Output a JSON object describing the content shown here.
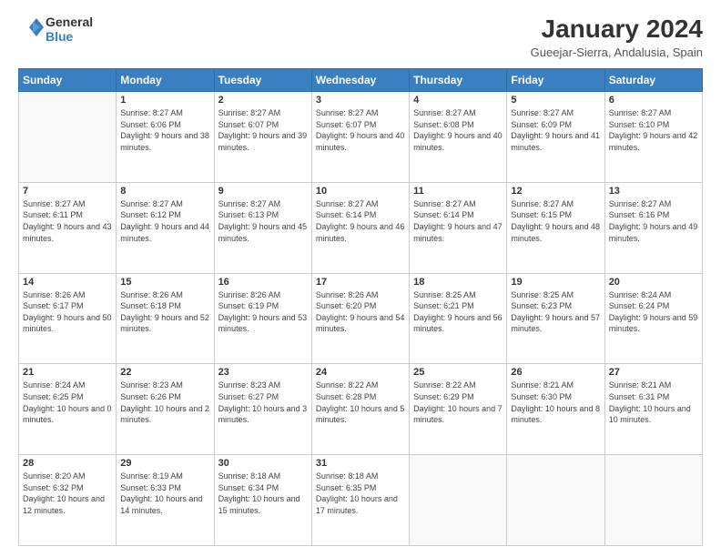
{
  "header": {
    "logo_line1": "General",
    "logo_line2": "Blue",
    "title": "January 2024",
    "location": "Gueejar-Sierra, Andalusia, Spain"
  },
  "days_of_week": [
    "Sunday",
    "Monday",
    "Tuesday",
    "Wednesday",
    "Thursday",
    "Friday",
    "Saturday"
  ],
  "weeks": [
    [
      {
        "day": "",
        "sunrise": "",
        "sunset": "",
        "daylight": ""
      },
      {
        "day": "1",
        "sunrise": "Sunrise: 8:27 AM",
        "sunset": "Sunset: 6:06 PM",
        "daylight": "Daylight: 9 hours and 38 minutes."
      },
      {
        "day": "2",
        "sunrise": "Sunrise: 8:27 AM",
        "sunset": "Sunset: 6:07 PM",
        "daylight": "Daylight: 9 hours and 39 minutes."
      },
      {
        "day": "3",
        "sunrise": "Sunrise: 8:27 AM",
        "sunset": "Sunset: 6:07 PM",
        "daylight": "Daylight: 9 hours and 40 minutes."
      },
      {
        "day": "4",
        "sunrise": "Sunrise: 8:27 AM",
        "sunset": "Sunset: 6:08 PM",
        "daylight": "Daylight: 9 hours and 40 minutes."
      },
      {
        "day": "5",
        "sunrise": "Sunrise: 8:27 AM",
        "sunset": "Sunset: 6:09 PM",
        "daylight": "Daylight: 9 hours and 41 minutes."
      },
      {
        "day": "6",
        "sunrise": "Sunrise: 8:27 AM",
        "sunset": "Sunset: 6:10 PM",
        "daylight": "Daylight: 9 hours and 42 minutes."
      }
    ],
    [
      {
        "day": "7",
        "sunrise": "Sunrise: 8:27 AM",
        "sunset": "Sunset: 6:11 PM",
        "daylight": "Daylight: 9 hours and 43 minutes."
      },
      {
        "day": "8",
        "sunrise": "Sunrise: 8:27 AM",
        "sunset": "Sunset: 6:12 PM",
        "daylight": "Daylight: 9 hours and 44 minutes."
      },
      {
        "day": "9",
        "sunrise": "Sunrise: 8:27 AM",
        "sunset": "Sunset: 6:13 PM",
        "daylight": "Daylight: 9 hours and 45 minutes."
      },
      {
        "day": "10",
        "sunrise": "Sunrise: 8:27 AM",
        "sunset": "Sunset: 6:14 PM",
        "daylight": "Daylight: 9 hours and 46 minutes."
      },
      {
        "day": "11",
        "sunrise": "Sunrise: 8:27 AM",
        "sunset": "Sunset: 6:14 PM",
        "daylight": "Daylight: 9 hours and 47 minutes."
      },
      {
        "day": "12",
        "sunrise": "Sunrise: 8:27 AM",
        "sunset": "Sunset: 6:15 PM",
        "daylight": "Daylight: 9 hours and 48 minutes."
      },
      {
        "day": "13",
        "sunrise": "Sunrise: 8:27 AM",
        "sunset": "Sunset: 6:16 PM",
        "daylight": "Daylight: 9 hours and 49 minutes."
      }
    ],
    [
      {
        "day": "14",
        "sunrise": "Sunrise: 8:26 AM",
        "sunset": "Sunset: 6:17 PM",
        "daylight": "Daylight: 9 hours and 50 minutes."
      },
      {
        "day": "15",
        "sunrise": "Sunrise: 8:26 AM",
        "sunset": "Sunset: 6:18 PM",
        "daylight": "Daylight: 9 hours and 52 minutes."
      },
      {
        "day": "16",
        "sunrise": "Sunrise: 8:26 AM",
        "sunset": "Sunset: 6:19 PM",
        "daylight": "Daylight: 9 hours and 53 minutes."
      },
      {
        "day": "17",
        "sunrise": "Sunrise: 8:26 AM",
        "sunset": "Sunset: 6:20 PM",
        "daylight": "Daylight: 9 hours and 54 minutes."
      },
      {
        "day": "18",
        "sunrise": "Sunrise: 8:25 AM",
        "sunset": "Sunset: 6:21 PM",
        "daylight": "Daylight: 9 hours and 56 minutes."
      },
      {
        "day": "19",
        "sunrise": "Sunrise: 8:25 AM",
        "sunset": "Sunset: 6:23 PM",
        "daylight": "Daylight: 9 hours and 57 minutes."
      },
      {
        "day": "20",
        "sunrise": "Sunrise: 8:24 AM",
        "sunset": "Sunset: 6:24 PM",
        "daylight": "Daylight: 9 hours and 59 minutes."
      }
    ],
    [
      {
        "day": "21",
        "sunrise": "Sunrise: 8:24 AM",
        "sunset": "Sunset: 6:25 PM",
        "daylight": "Daylight: 10 hours and 0 minutes."
      },
      {
        "day": "22",
        "sunrise": "Sunrise: 8:23 AM",
        "sunset": "Sunset: 6:26 PM",
        "daylight": "Daylight: 10 hours and 2 minutes."
      },
      {
        "day": "23",
        "sunrise": "Sunrise: 8:23 AM",
        "sunset": "Sunset: 6:27 PM",
        "daylight": "Daylight: 10 hours and 3 minutes."
      },
      {
        "day": "24",
        "sunrise": "Sunrise: 8:22 AM",
        "sunset": "Sunset: 6:28 PM",
        "daylight": "Daylight: 10 hours and 5 minutes."
      },
      {
        "day": "25",
        "sunrise": "Sunrise: 8:22 AM",
        "sunset": "Sunset: 6:29 PM",
        "daylight": "Daylight: 10 hours and 7 minutes."
      },
      {
        "day": "26",
        "sunrise": "Sunrise: 8:21 AM",
        "sunset": "Sunset: 6:30 PM",
        "daylight": "Daylight: 10 hours and 8 minutes."
      },
      {
        "day": "27",
        "sunrise": "Sunrise: 8:21 AM",
        "sunset": "Sunset: 6:31 PM",
        "daylight": "Daylight: 10 hours and 10 minutes."
      }
    ],
    [
      {
        "day": "28",
        "sunrise": "Sunrise: 8:20 AM",
        "sunset": "Sunset: 6:32 PM",
        "daylight": "Daylight: 10 hours and 12 minutes."
      },
      {
        "day": "29",
        "sunrise": "Sunrise: 8:19 AM",
        "sunset": "Sunset: 6:33 PM",
        "daylight": "Daylight: 10 hours and 14 minutes."
      },
      {
        "day": "30",
        "sunrise": "Sunrise: 8:18 AM",
        "sunset": "Sunset: 6:34 PM",
        "daylight": "Daylight: 10 hours and 15 minutes."
      },
      {
        "day": "31",
        "sunrise": "Sunrise: 8:18 AM",
        "sunset": "Sunset: 6:35 PM",
        "daylight": "Daylight: 10 hours and 17 minutes."
      },
      {
        "day": "",
        "sunrise": "",
        "sunset": "",
        "daylight": ""
      },
      {
        "day": "",
        "sunrise": "",
        "sunset": "",
        "daylight": ""
      },
      {
        "day": "",
        "sunrise": "",
        "sunset": "",
        "daylight": ""
      }
    ]
  ]
}
